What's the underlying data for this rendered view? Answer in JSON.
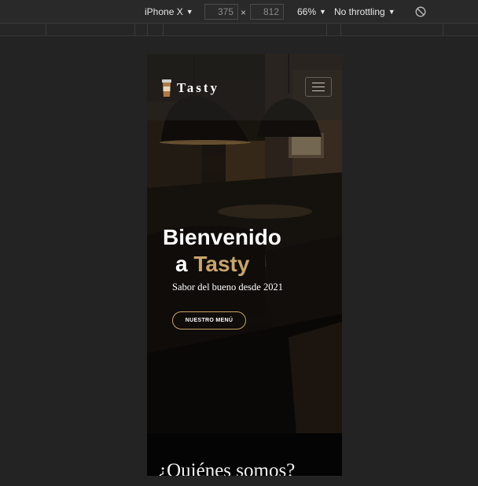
{
  "toolbar": {
    "device_label": "iPhone X",
    "width_value": "375",
    "times_symbol": "×",
    "height_value": "812",
    "zoom_label": "66%",
    "throttle_label": "No throttling"
  },
  "site": {
    "brand": "Tasty",
    "hero": {
      "title_line1": "Bienvenido",
      "title_line2_prefix": "a",
      "title_line2_accent": "Tasty",
      "subtitle": "Sabor del bueno desde 2021",
      "button_label": "NUESTRO MENÚ"
    },
    "about_title": "¿Quiénes somos?"
  },
  "colors": {
    "accent": "#c9a46b",
    "background": "#232323"
  }
}
